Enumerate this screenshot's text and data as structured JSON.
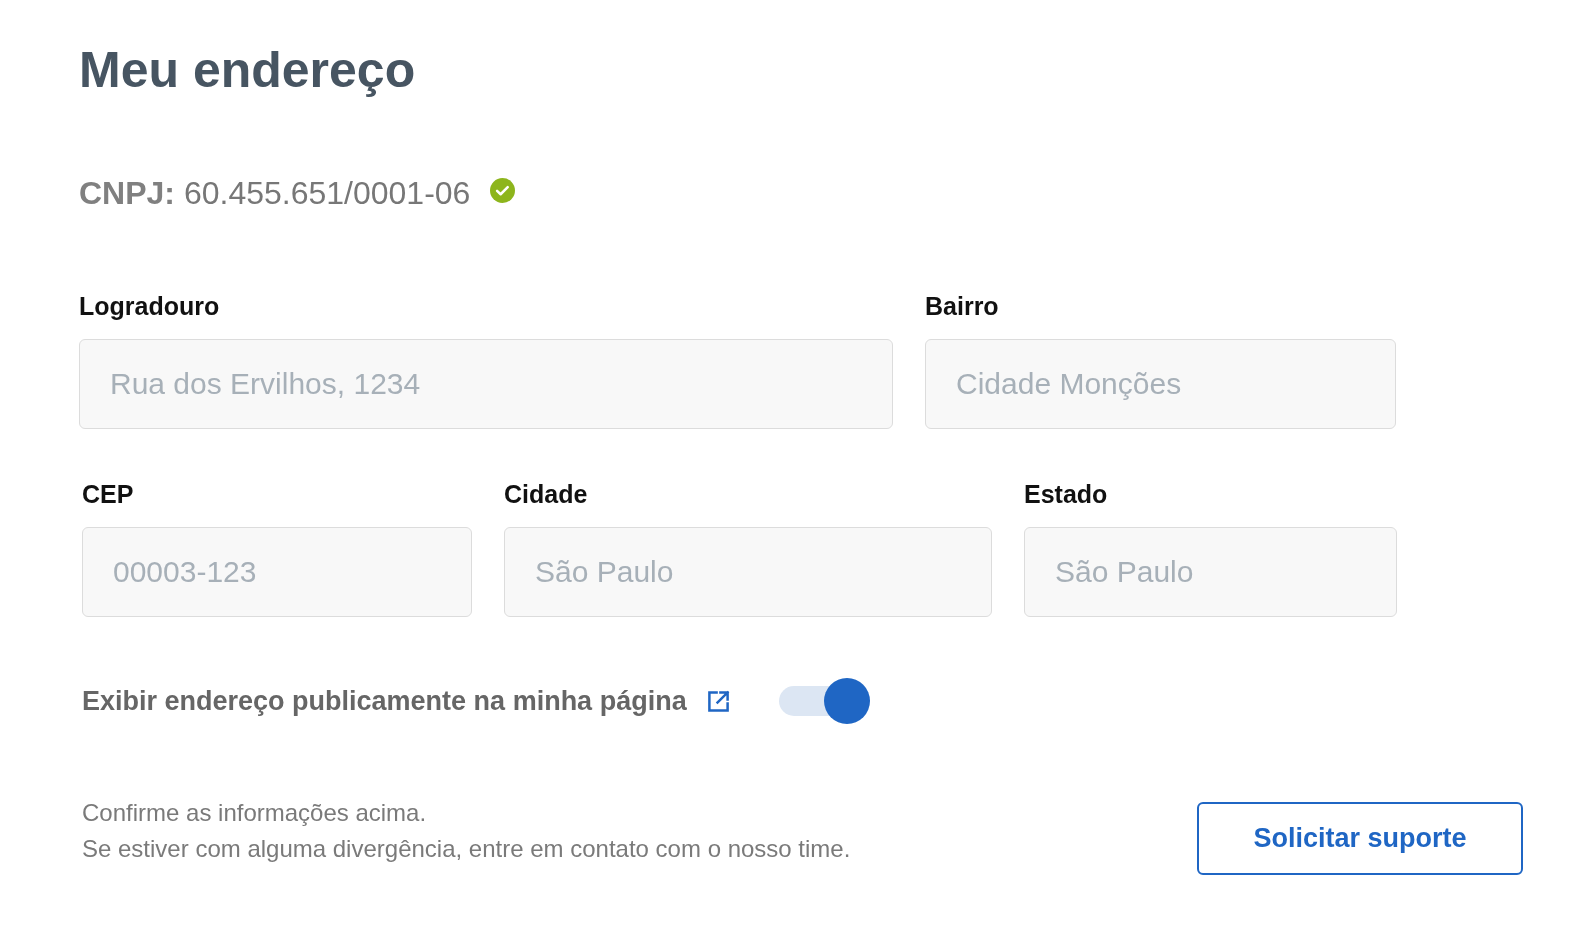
{
  "title": "Meu endereço",
  "cnpj": {
    "text": "**CNPJ:** 60.455.651/0001-06",
    "verified": true
  },
  "address_form": {
    "rows": [
      {
        "fields": [
          {
            "label": "Logradouro",
            "value": "Rua dos Ervilhos, 1234",
            "disabled": true
          },
          {
            "label": "Bairro",
            "value": "Cidade Monções",
            "disabled": true
          }
        ]
      },
      {
        "fields": [
          {
            "label": "CEP",
            "value": "00003-123",
            "disabled": true
          },
          {
            "label": "Cidade",
            "value": "São Paulo",
            "disabled": true
          },
          {
            "label": "Estado",
            "value": "São Paulo",
            "disabled": true
          }
        ]
      }
    ]
  },
  "public_address": {
    "label": "Exibir endereço publicamente na minha página",
    "on": true
  },
  "footer": {
    "notice_lines": [
      "Confirme as informações acima.",
      "Se estiver com alguma divergência, entre em contato com o nosso time."
    ],
    "support_button": "Solicitar suporte"
  }
}
